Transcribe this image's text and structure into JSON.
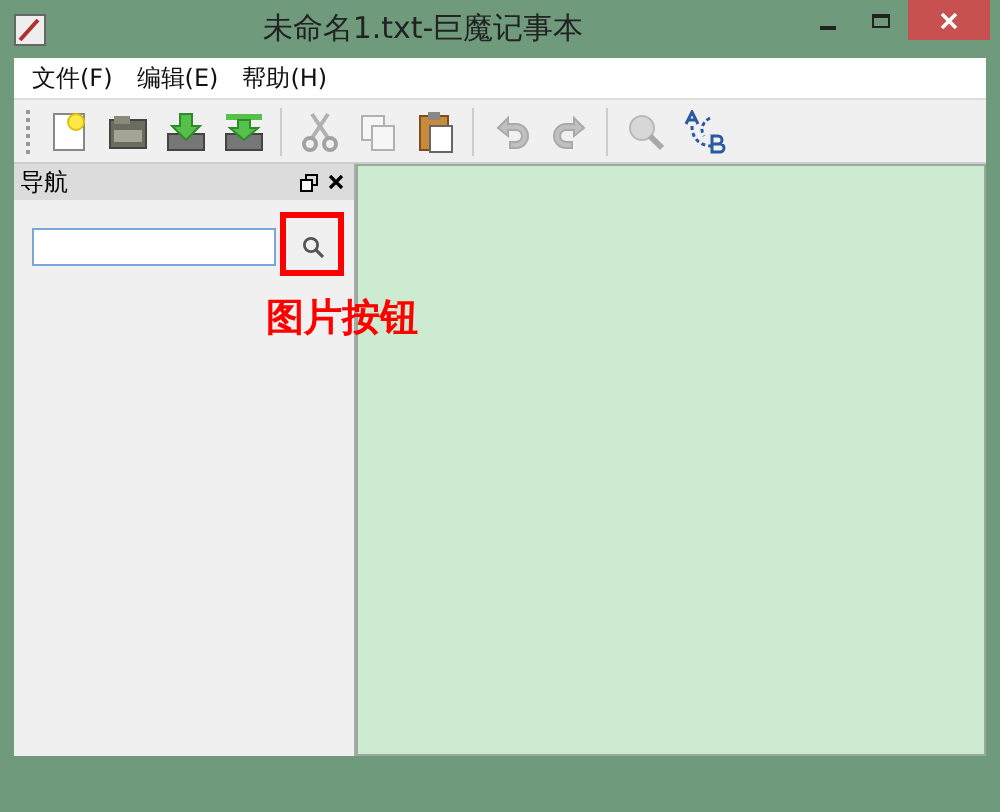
{
  "window": {
    "title": "未命名1.txt-巨魔记事本"
  },
  "menu": [
    "文件(F)",
    "编辑(E)",
    "帮助(H)"
  ],
  "toolbar": [
    [
      {
        "kind": "new",
        "disabled": false
      },
      {
        "kind": "open",
        "disabled": false
      },
      {
        "kind": "save",
        "disabled": false
      },
      {
        "kind": "saveas",
        "disabled": false
      }
    ],
    [
      {
        "kind": "cut",
        "disabled": true
      },
      {
        "kind": "copy",
        "disabled": true
      },
      {
        "kind": "paste",
        "disabled": false
      }
    ],
    [
      {
        "kind": "undo",
        "disabled": true
      },
      {
        "kind": "redo",
        "disabled": true
      }
    ],
    [
      {
        "kind": "find",
        "disabled": true
      },
      {
        "kind": "replace",
        "disabled": false
      }
    ]
  ],
  "nav_panel": {
    "title": "导航"
  },
  "annotation": {
    "text": "图片按钮"
  }
}
